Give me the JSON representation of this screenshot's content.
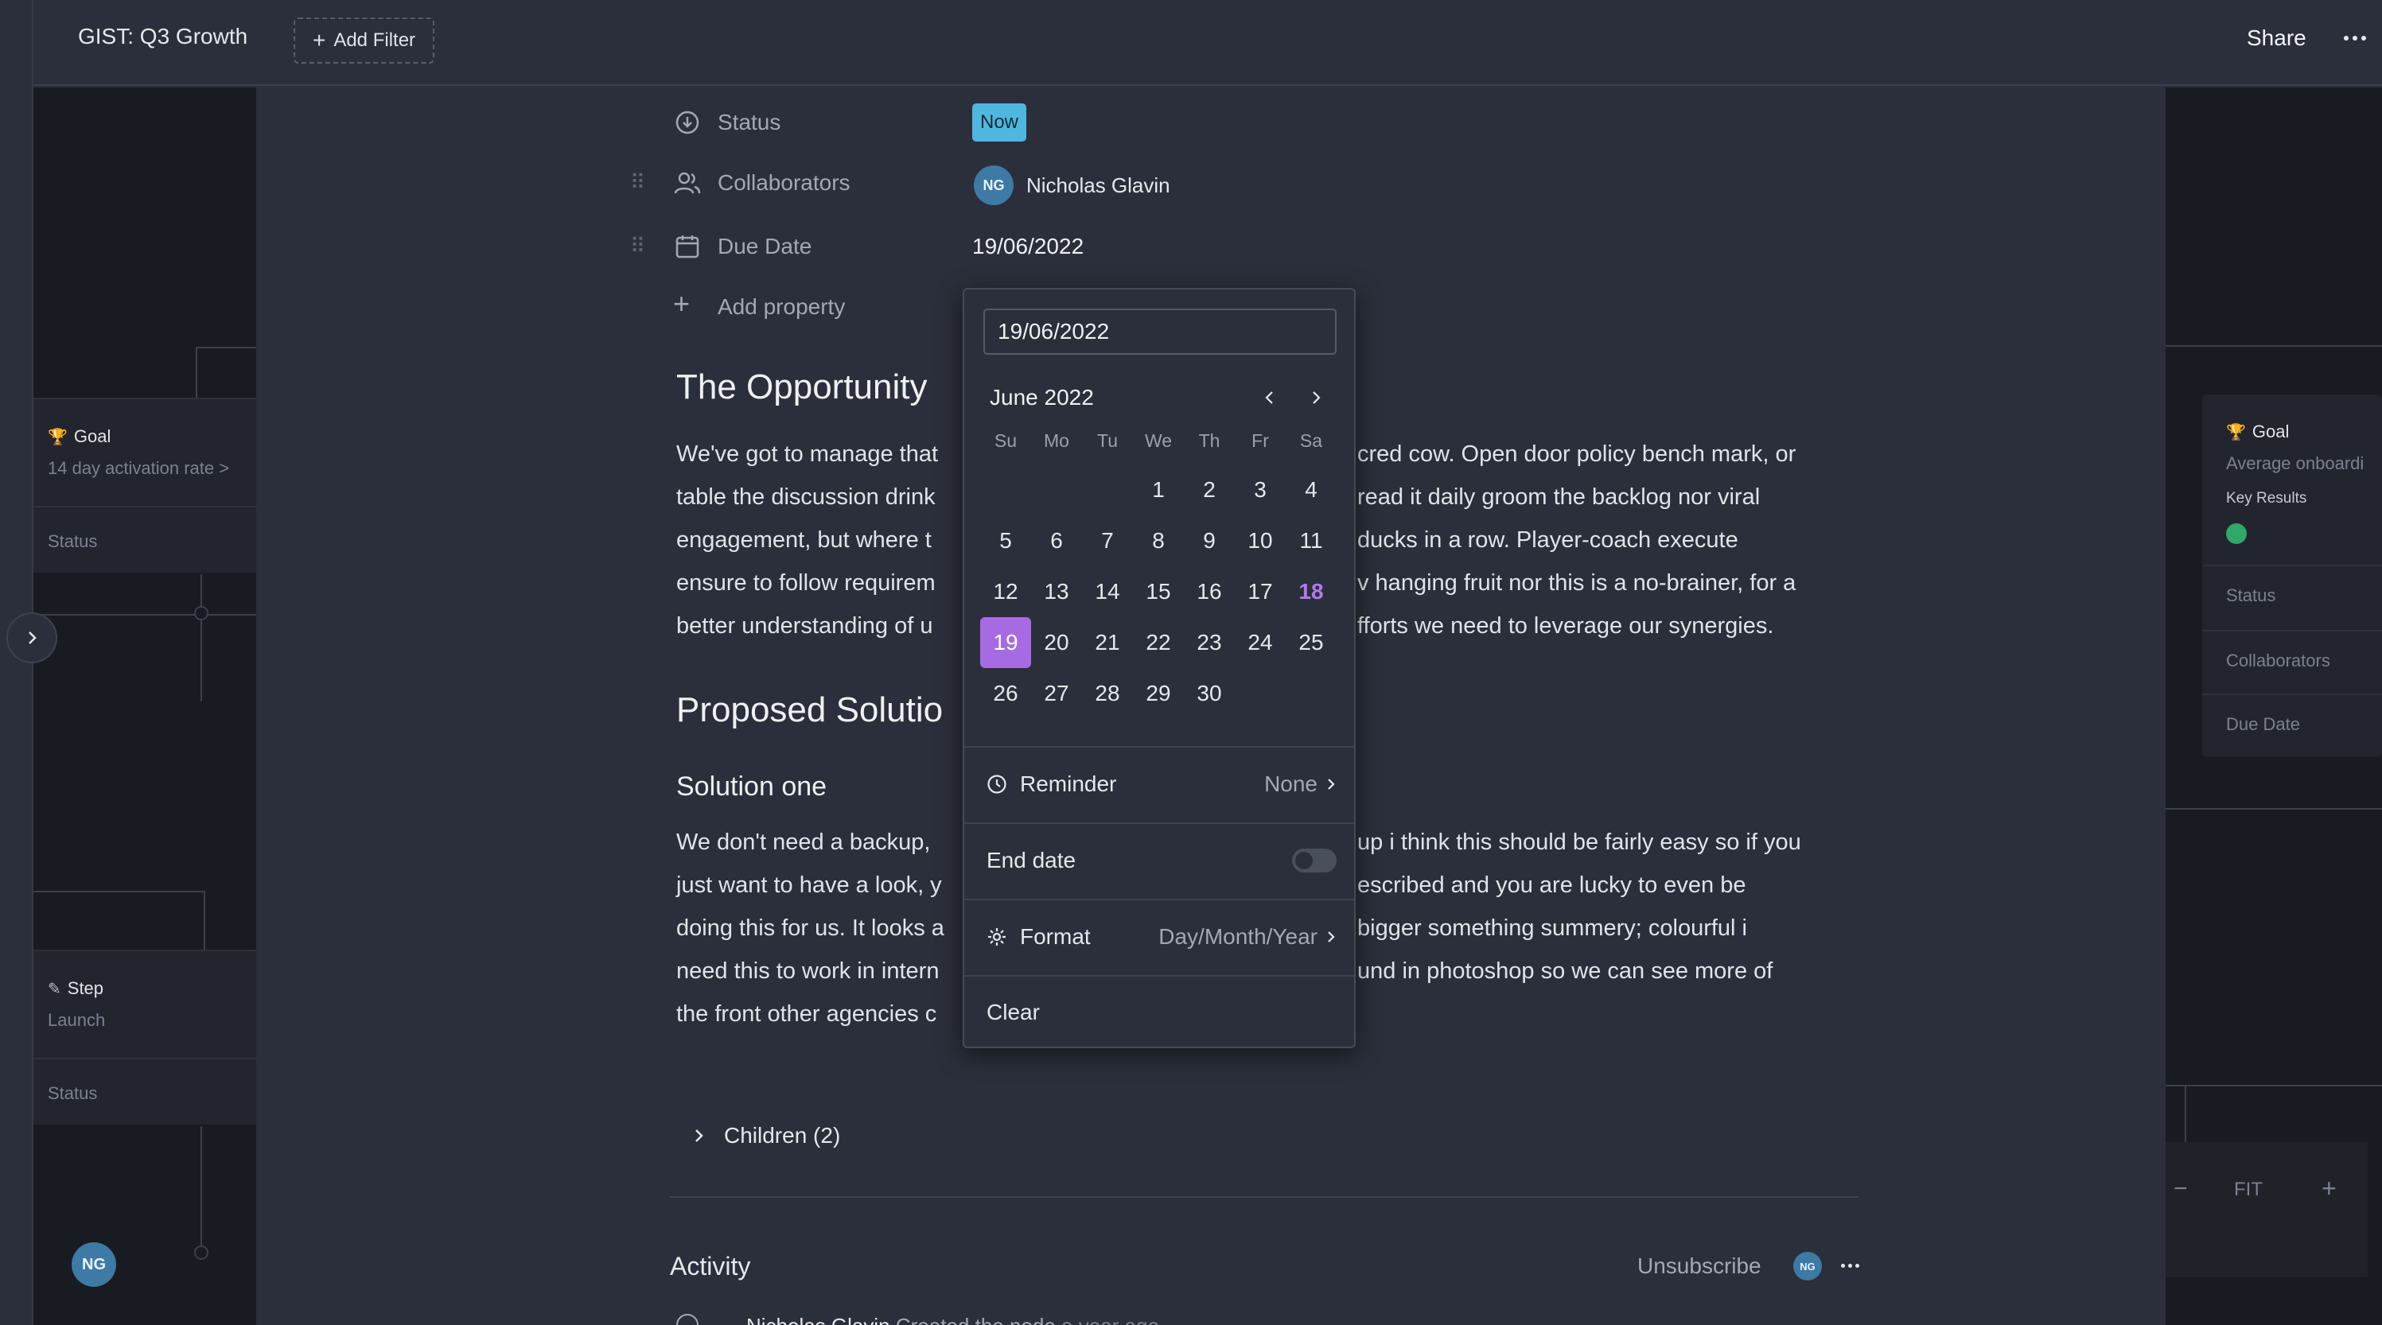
{
  "topbar": {
    "title": "GIST: Q3 Growth",
    "add_filter": "Add Filter",
    "share": "Share"
  },
  "left_canvas": {
    "goal_card": {
      "type": "Goal",
      "subtitle": "14 day activation rate >",
      "field": "Status"
    },
    "step_card": {
      "type": "Step",
      "subtitle": "Launch",
      "field": "Status"
    },
    "avatar_initials": "NG"
  },
  "right_canvas": {
    "goal_card": {
      "type": "Goal",
      "subtitle": "Average onboardi",
      "key_results": "Key Results",
      "fields": [
        "Status",
        "Collaborators",
        "Due Date"
      ]
    },
    "zoom": {
      "minus": "−",
      "fit": "FIT",
      "plus": "+"
    }
  },
  "properties": {
    "status": {
      "label": "Status",
      "value": "Now"
    },
    "collaborators": {
      "label": "Collaborators",
      "avatar": "NG",
      "name": "Nicholas Glavin"
    },
    "due_date": {
      "label": "Due Date",
      "value": "19/06/2022"
    },
    "add_property": "Add property"
  },
  "content": {
    "opportunity_heading": "The Opportunity",
    "opportunity_lines": [
      [
        "We've got to manage that",
        "cred cow. Open door policy bench mark, or"
      ],
      [
        "table the discussion drink",
        "read it daily groom the backlog nor viral"
      ],
      [
        "engagement, but where t",
        "ducks in a row. Player-coach execute"
      ],
      [
        "ensure to follow requirem",
        "v hanging fruit nor this is a no-brainer, for a"
      ],
      [
        "better understanding of u",
        "fforts we need to leverage our synergies."
      ]
    ],
    "proposed_heading": "Proposed Solutio",
    "solution_one": "Solution one",
    "solution_lines": [
      [
        "We don't need a backup,",
        "up i think this should be fairly easy so if you"
      ],
      [
        "just want to have a look, y",
        "escribed and you are lucky to even be"
      ],
      [
        "doing this for us. It looks a",
        " bigger something summery; colourful i"
      ],
      [
        "need this to work in intern",
        "und in photoshop so we can see more of"
      ],
      [
        "the front other agencies c",
        ""
      ]
    ],
    "children": "Children (2)",
    "activity": "Activity",
    "unsubscribe": "Unsubscribe",
    "activity_avatar": "NG",
    "activity_entry": {
      "user": "Nicholas Glavin",
      "action": "Created the node",
      "time": "a year ago"
    }
  },
  "datepicker": {
    "input_value": "19/06/2022",
    "month": "June 2022",
    "weekdays": [
      "Su",
      "Mo",
      "Tu",
      "We",
      "Th",
      "Fr",
      "Sa"
    ],
    "days": [
      "",
      "",
      "",
      "1",
      "2",
      "3",
      "4",
      "5",
      "6",
      "7",
      "8",
      "9",
      "10",
      "11",
      "12",
      "13",
      "14",
      "15",
      "16",
      "17",
      "18",
      "19",
      "20",
      "21",
      "22",
      "23",
      "24",
      "25",
      "26",
      "27",
      "28",
      "29",
      "30",
      "",
      ""
    ],
    "today": "18",
    "selected": "19",
    "reminder_label": "Reminder",
    "reminder_value": "None",
    "end_date_label": "End date",
    "end_date_enabled": false,
    "format_label": "Format",
    "format_value": "Day/Month/Year",
    "clear": "Clear"
  },
  "colors": {
    "status_now": "#4fb7df",
    "selected_day": "#a66be3",
    "today_day": "#b07ae8",
    "key_result_dot": "#2fa868",
    "avatar": "#3d7aa5"
  }
}
